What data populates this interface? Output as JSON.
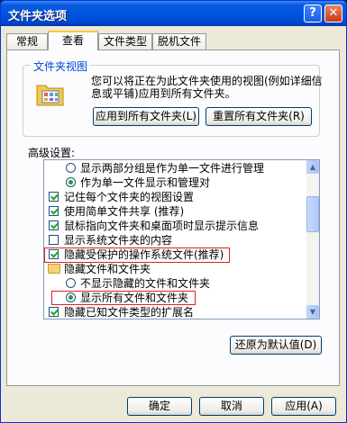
{
  "window": {
    "title": "文件夹选项",
    "help": "?",
    "close": "✕"
  },
  "tabs": [
    "常规",
    "查看",
    "文件类型",
    "脱机文件"
  ],
  "folder_views": {
    "title": "文件夹视图",
    "description": "您可以将正在为此文件夹使用的视图(例如详细信息或平铺)应用到所有文件夹。",
    "apply_button": "应用到所有文件夹(L)",
    "reset_button": "重置所有文件夹(R)"
  },
  "advanced": {
    "label": "高级设置:",
    "items": [
      {
        "type": "radio",
        "checked": false,
        "indent": 2,
        "text": "显示两部分组是作为单一文件进行管理"
      },
      {
        "type": "radio",
        "checked": true,
        "indent": 2,
        "text": "作为单一文件显示和管理对"
      },
      {
        "type": "checkbox",
        "checked": true,
        "indent": 0,
        "text": "记住每个文件夹的视图设置"
      },
      {
        "type": "checkbox",
        "checked": true,
        "indent": 0,
        "text": "使用简单文件共享 (推荐)"
      },
      {
        "type": "checkbox",
        "checked": true,
        "indent": 0,
        "text": "鼠标指向文件夹和桌面项时显示提示信息"
      },
      {
        "type": "checkbox",
        "checked": false,
        "indent": 0,
        "text": "显示系统文件夹的内容"
      },
      {
        "type": "checkbox",
        "checked": true,
        "indent": 0,
        "text": "隐藏受保护的操作系统文件(推荐)"
      },
      {
        "type": "folder",
        "indent": 0,
        "text": "隐藏文件和文件夹"
      },
      {
        "type": "radio",
        "checked": false,
        "indent": 1,
        "text": "不显示隐藏的文件和文件夹"
      },
      {
        "type": "radio",
        "checked": true,
        "indent": 1,
        "text": "显示所有文件和文件夹"
      },
      {
        "type": "checkbox",
        "checked": true,
        "indent": 0,
        "text": "隐藏已知文件类型的扩展名"
      }
    ]
  },
  "restore_button": "还原为默认值(D)",
  "footer": {
    "ok": "确定",
    "cancel": "取消",
    "apply": "应用(A)"
  }
}
